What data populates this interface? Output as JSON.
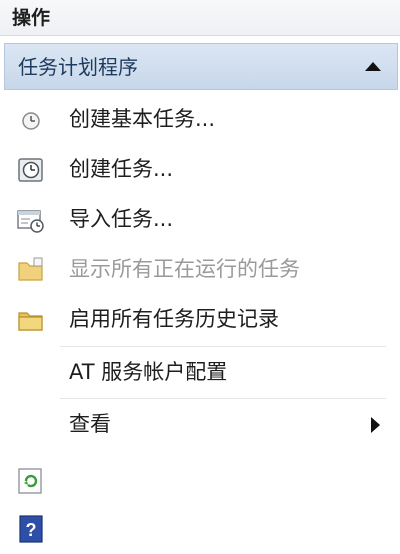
{
  "pane": {
    "title": "操作"
  },
  "group": {
    "label": "任务计划程序",
    "expanded": true
  },
  "items": [
    {
      "label": "创建基本任务...",
      "icon": "basic-task-clock-icon",
      "disabled": false
    },
    {
      "label": "创建任务...",
      "icon": "task-clock-icon",
      "disabled": false
    },
    {
      "label": "导入任务...",
      "icon": "import-task-icon",
      "disabled": false
    },
    {
      "label": "显示所有正在运行的任务",
      "icon": "running-tasks-folder-icon",
      "disabled": true
    },
    {
      "label": "启用所有任务历史记录",
      "icon": "history-folder-icon",
      "disabled": false
    },
    {
      "label": "AT 服务帐户配置",
      "icon": "",
      "disabled": false
    },
    {
      "label": "查看",
      "icon": "",
      "disabled": false,
      "submenu": true
    }
  ],
  "footer_icons": [
    "refresh-icon",
    "help-icon"
  ],
  "colors": {
    "group_header": "#c7d7ea",
    "disabled_text": "#9a9a9a",
    "folder": "#e8c25a",
    "help_blue": "#2d4fa8",
    "refresh_green": "#3a9b3a"
  }
}
